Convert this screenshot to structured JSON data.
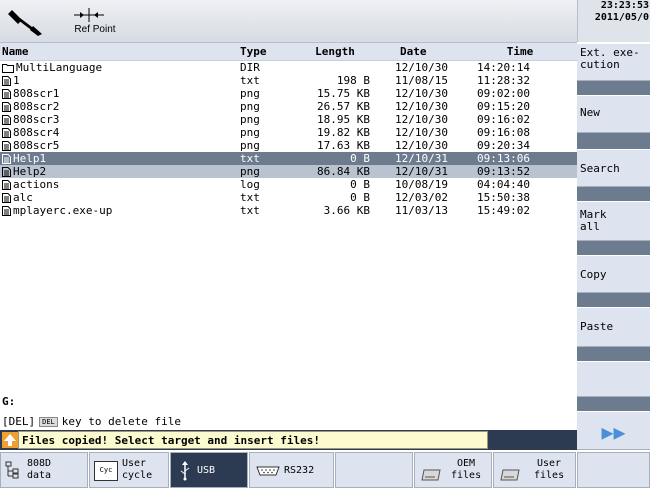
{
  "header": {
    "refpoint_label": "Ref Point",
    "clock_time": "23:23:53",
    "clock_date": "2011/05/0"
  },
  "columns": {
    "name": "Name",
    "type": "Type",
    "length": "Length",
    "date": "Date",
    "time": "Time"
  },
  "files": [
    {
      "name": "MultiLanguage",
      "type": "DIR",
      "length": "",
      "date": "12/10/30",
      "time": "14:20:14",
      "icon": "folder-icon"
    },
    {
      "name": "1",
      "type": "txt",
      "length": "198 B",
      "date": "11/08/15",
      "time": "11:28:32",
      "icon": "file-icon"
    },
    {
      "name": "808scr1",
      "type": "png",
      "length": "15.75 KB",
      "date": "12/10/30",
      "time": "09:02:00",
      "icon": "file-icon"
    },
    {
      "name": "808scr2",
      "type": "png",
      "length": "26.57 KB",
      "date": "12/10/30",
      "time": "09:15:20",
      "icon": "file-icon"
    },
    {
      "name": "808scr3",
      "type": "png",
      "length": "18.95 KB",
      "date": "12/10/30",
      "time": "09:16:02",
      "icon": "file-icon"
    },
    {
      "name": "808scr4",
      "type": "png",
      "length": "19.82 KB",
      "date": "12/10/30",
      "time": "09:16:08",
      "icon": "file-icon"
    },
    {
      "name": "808scr5",
      "type": "png",
      "length": "17.63 KB",
      "date": "12/10/30",
      "time": "09:20:34",
      "icon": "file-icon"
    },
    {
      "name": "Help1",
      "type": "txt",
      "length": "0 B",
      "date": "12/10/31",
      "time": "09:13:06",
      "icon": "file-icon"
    },
    {
      "name": "Help2",
      "type": "png",
      "length": "86.84 KB",
      "date": "12/10/31",
      "time": "09:13:52",
      "icon": "file-icon"
    },
    {
      "name": "actions",
      "type": "log",
      "length": "0 B",
      "date": "10/08/19",
      "time": "04:04:40",
      "icon": "file-icon"
    },
    {
      "name": "alc",
      "type": "txt",
      "length": "0 B",
      "date": "12/03/02",
      "time": "15:50:38",
      "icon": "file-icon"
    },
    {
      "name": "mplayerc.exe-up",
      "type": "txt",
      "length": "3.66 KB",
      "date": "11/03/13",
      "time": "15:49:02",
      "icon": "file-icon"
    }
  ],
  "status": {
    "path": "G:",
    "hint_prefix": "[DEL]",
    "hint_key": "DEL",
    "hint_suffix": "key to delete file",
    "message": "Files copied! Select target and insert files!"
  },
  "softkeys_right": {
    "ext_execution_l1": "Ext. exe-",
    "ext_execution_l2": "cution",
    "new": "New",
    "search": "Search",
    "mark_all_l1": "Mark",
    "mark_all_l2": "all",
    "copy": "Copy",
    "paste": "Paste",
    "next": "▶▶"
  },
  "softkeys_bottom": {
    "data_808d_l1": "808D",
    "data_808d_l2": "data",
    "user_cycle_l1": "User",
    "user_cycle_l2": "cycle",
    "user_cycle_icon": "Cyc",
    "usb": "USB",
    "rs232": "RS232",
    "oem_files_l1": "OEM",
    "oem_files_l2": "files",
    "user_files_l1": "User",
    "user_files_l2": "files"
  },
  "colors": {
    "selected_row": "#6c7b8e",
    "secondary_row": "#b9c2cf",
    "panel": "#dde4ef",
    "message_bg": "#fbfbcf",
    "dark_bar": "#2c3b52",
    "accent_arrow": "#f0a030"
  }
}
